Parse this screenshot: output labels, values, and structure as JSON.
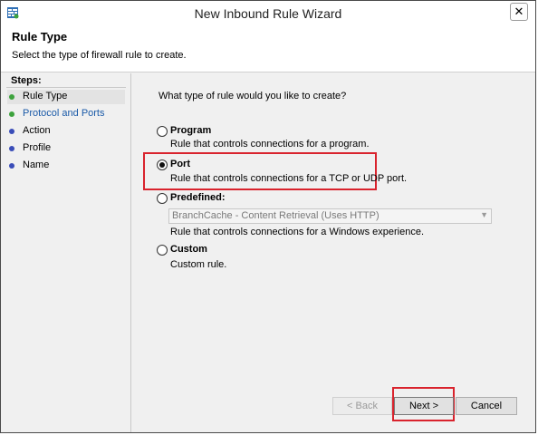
{
  "window": {
    "title": "New Inbound Rule Wizard",
    "close_glyph": "✕"
  },
  "header": {
    "title": "Rule Type",
    "subtitle": "Select the type of firewall rule to create."
  },
  "sidebar": {
    "steps_title": "Steps:",
    "items": [
      {
        "label": "Rule Type",
        "dot_color": "#3da23d"
      },
      {
        "label": "Protocol and Ports",
        "dot_color": "#3da23d"
      },
      {
        "label": "Action",
        "dot_color": "#3a4db8"
      },
      {
        "label": "Profile",
        "dot_color": "#3a4db8"
      },
      {
        "label": "Name",
        "dot_color": "#3a4db8"
      }
    ]
  },
  "main": {
    "question": "What type of rule would you like to create?",
    "options": [
      {
        "label": "Program",
        "description": "Rule that controls connections for a program."
      },
      {
        "label": "Port",
        "description": "Rule that controls connections for a TCP or UDP port."
      },
      {
        "label": "Predefined:",
        "description": "Rule that controls connections for a Windows experience."
      },
      {
        "label": "Custom",
        "description": "Custom rule."
      }
    ],
    "selected_option": "Port",
    "predefined_value": "BranchCache - Content Retrieval (Uses HTTP)"
  },
  "buttons": {
    "back": "< Back",
    "next": "Next >",
    "cancel": "Cancel"
  },
  "colors": {
    "highlight": "#d9232d",
    "link": "#1a5aa8"
  }
}
